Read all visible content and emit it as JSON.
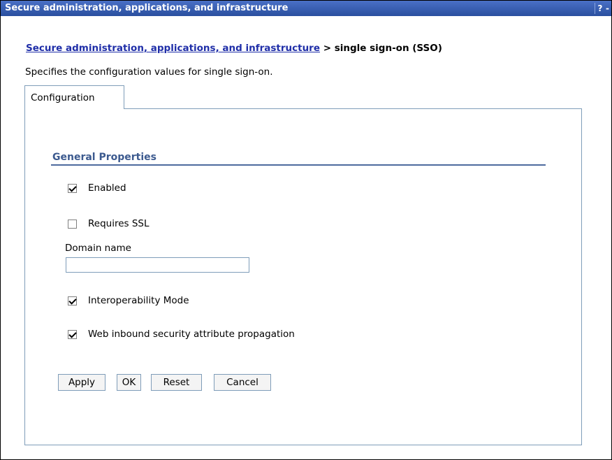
{
  "window": {
    "title": "Secure administration, applications, and infrastructure",
    "help_label": "?",
    "minimize_label": "-"
  },
  "breadcrumb": {
    "parent_link": "Secure administration, applications, and infrastructure",
    "separator": ">",
    "current": "single sign-on (SSO)"
  },
  "page": {
    "description": "Specifies the configuration values for single sign-on."
  },
  "tabs": [
    {
      "label": "Configuration",
      "selected": true
    }
  ],
  "general_properties": {
    "heading": "General Properties",
    "enabled": {
      "label": "Enabled",
      "checked": true
    },
    "requires_ssl": {
      "label": "Requires SSL",
      "checked": false
    },
    "domain_name": {
      "label": "Domain name",
      "value": ""
    },
    "interoperability_mode": {
      "label": "Interoperability Mode",
      "checked": true
    },
    "web_inbound": {
      "label": "Web inbound security attribute propagation",
      "checked": true
    }
  },
  "buttons": {
    "apply": "Apply",
    "ok": "OK",
    "reset": "Reset",
    "cancel": "Cancel"
  }
}
